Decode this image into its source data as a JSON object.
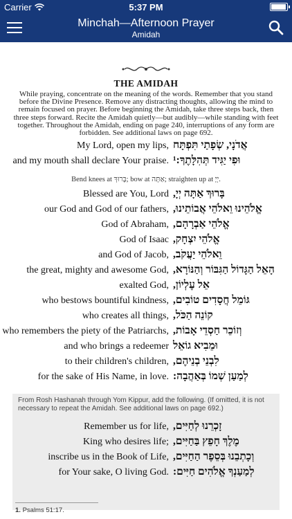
{
  "status_bar": {
    "carrier": "Carrier",
    "time": "5:37 PM"
  },
  "nav": {
    "title": "Minchah—Afternoon Prayer",
    "subtitle": "Amidah"
  },
  "section": {
    "heading": "THE AMIDAH",
    "intro": "While praying, concentrate on the meaning of the words. Remember that you stand before the Divine Presence. Remove any distracting thoughts, allowing the mind to remain focused on prayer. Before beginning the Amidah, take three steps back, then three steps forward. Recite the Amidah quietly—but audibly—while standing with feet together. Throughout the Amidah, ending on page 240, interruptions of any form are forbidden. See additional laws on page 692.",
    "opening": [
      {
        "en": "My Lord, open my lips,",
        "he": "אֲדֹנָי, שְׂפָתַי תִּפְתָּח"
      },
      {
        "en": "and my mouth shall declare Your praise.",
        "he": "וּפִי יַגִּיד תְּהִלָּתֶךָ:¹"
      }
    ],
    "instruction": "Bend knees at בָּרוּךְ; bow at אַתָּה; straighten up at יְיָ.",
    "blessing": [
      {
        "en": "Blessed are You, Lord",
        "he": "בָּרוּךְ אַתָּה יְיָ,"
      },
      {
        "en": "our God and God of our fathers,",
        "he": "אֱלֹהֵינוּ וֵאלֹהֵי אֲבוֹתֵינוּ,"
      },
      {
        "en": "God of Abraham,",
        "he": "אֱלֹהֵי אַבְרָהָם,"
      },
      {
        "en": "God of Isaac",
        "he": "אֱלֹהֵי יִצְחָק,"
      },
      {
        "en": "and God of Jacob,",
        "he": "וֵאלֹהֵי יַעֲקֹב,"
      },
      {
        "en": "the great, mighty and awesome God,",
        "he": "הָאֵל הַגָּדוֹל הַגִּבּוֹר וְהַנּוֹרָא,"
      },
      {
        "en": "exalted God,",
        "he": "אֵל עֶלְיוֹן,"
      },
      {
        "en": "who bestows bountiful kindness,",
        "he": "גּוֹמֵל חֲסָדִים טוֹבִים,"
      },
      {
        "en": "who creates all things,",
        "he": "קוֹנֵה הַכֹּל,"
      },
      {
        "en": "who remembers the piety of the Patriarchs,",
        "he": "וְזוֹכֵר חַסְדֵי אָבוֹת,"
      },
      {
        "en": "and who brings a redeemer",
        "he": "וּמֵבִיא גוֹאֵל"
      },
      {
        "en": "to their children's children,",
        "he": "לִבְנֵי בְנֵיהֶם,"
      },
      {
        "en": "for the sake of His Name, in love.",
        "he": "לְמַעַן שְׁמוֹ בְּאַהֲבָה:"
      }
    ],
    "insert_note": "From Rosh Hashanah through Yom Kippur, add the following. (If omitted, it is not necessary to repeat the Amidah. See additional laws on page 692.)",
    "insert": [
      {
        "en": "Remember us for life,",
        "he": "זָכְרֵנוּ לְחַיִּים,"
      },
      {
        "en": "King who desires life;",
        "he": "מֶלֶךְ חָפֵץ בַּחַיִּים,"
      },
      {
        "en": "inscribe us in the Book of Life,",
        "he": "וְכָתְבֵנוּ בְּסֵפֶר הַחַיִּים,"
      },
      {
        "en": "for Your sake, O living God.",
        "he": "לְמַעַנְךָ אֱלֹהִים חַיִּים:"
      }
    ],
    "footnote_num": "1.",
    "footnote_text": "Psalms 51:17."
  }
}
